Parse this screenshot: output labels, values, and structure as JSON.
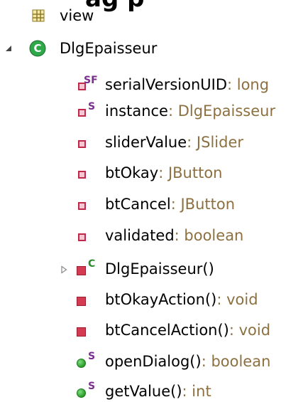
{
  "top_cut_text": "ag p",
  "tree": {
    "package": {
      "label": "view",
      "icon": "package-icon"
    },
    "class": {
      "label": "DlgEpaisseur",
      "icon": "class-icon",
      "expander": "expanded-arrow-icon",
      "members": [
        {
          "kind": "field",
          "static": true,
          "final": true,
          "name": "serialVersionUID",
          "type": " : long",
          "modifier": "SF"
        },
        {
          "kind": "field",
          "static": true,
          "name": "instance",
          "type": " : DlgEpaisseur",
          "modifier": "S"
        },
        {
          "kind": "field",
          "name": "sliderValue",
          "type": " : JSlider"
        },
        {
          "kind": "field",
          "name": "btOkay",
          "type": " : JButton"
        },
        {
          "kind": "field",
          "name": "btCancel",
          "type": " : JButton"
        },
        {
          "kind": "field",
          "name": "validated",
          "type": " : boolean"
        },
        {
          "kind": "constructor",
          "name": "DlgEpaisseur()",
          "type": "",
          "modifier": "C",
          "expander": "collapsed-arrow-icon"
        },
        {
          "kind": "method",
          "name": "btOkayAction()",
          "type": " : void"
        },
        {
          "kind": "method",
          "name": "btCancelAction()",
          "type": " : void"
        },
        {
          "kind": "public-method",
          "name": "openDialog()",
          "type": " : boolean",
          "modifier": "S"
        },
        {
          "kind": "public-method",
          "name": "getValue()",
          "type": " : int",
          "modifier": "S"
        }
      ]
    }
  },
  "colors": {
    "type_text": "#8c7040",
    "private_red": "#c0284c",
    "public_green": "#2a9a2a",
    "class_green": "#1f8f3a"
  }
}
